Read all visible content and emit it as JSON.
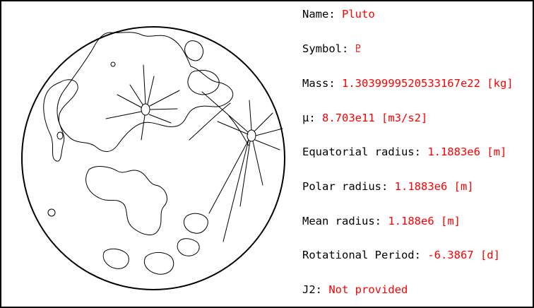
{
  "body": {
    "name": "Pluto",
    "symbol": "♇"
  },
  "properties": [
    {
      "label": "Name: ",
      "value": "Pluto"
    },
    {
      "label": "Symbol: ",
      "value": "♇"
    },
    {
      "label": "Mass: ",
      "value": "1.3039999520533167e22 [kg]"
    },
    {
      "label": "μ: ",
      "value": "8.703e11 [m3/s2]"
    },
    {
      "label": "Equatorial radius: ",
      "value": "1.1883e6 [m]"
    },
    {
      "label": "Polar radius: ",
      "value": "1.1883e6 [m]"
    },
    {
      "label": "Mean radius: ",
      "value": "1.188e6 [m]"
    },
    {
      "label": "Rotational Period: ",
      "value": "-6.3867 [d]"
    },
    {
      "label": "J2: ",
      "value": "Not provided"
    }
  ],
  "colors": {
    "label": "#000000",
    "value": "#ff0000",
    "border": "#000000",
    "background": "#ffffff"
  },
  "icons": {
    "illustration": "moon-sketch-icon"
  }
}
